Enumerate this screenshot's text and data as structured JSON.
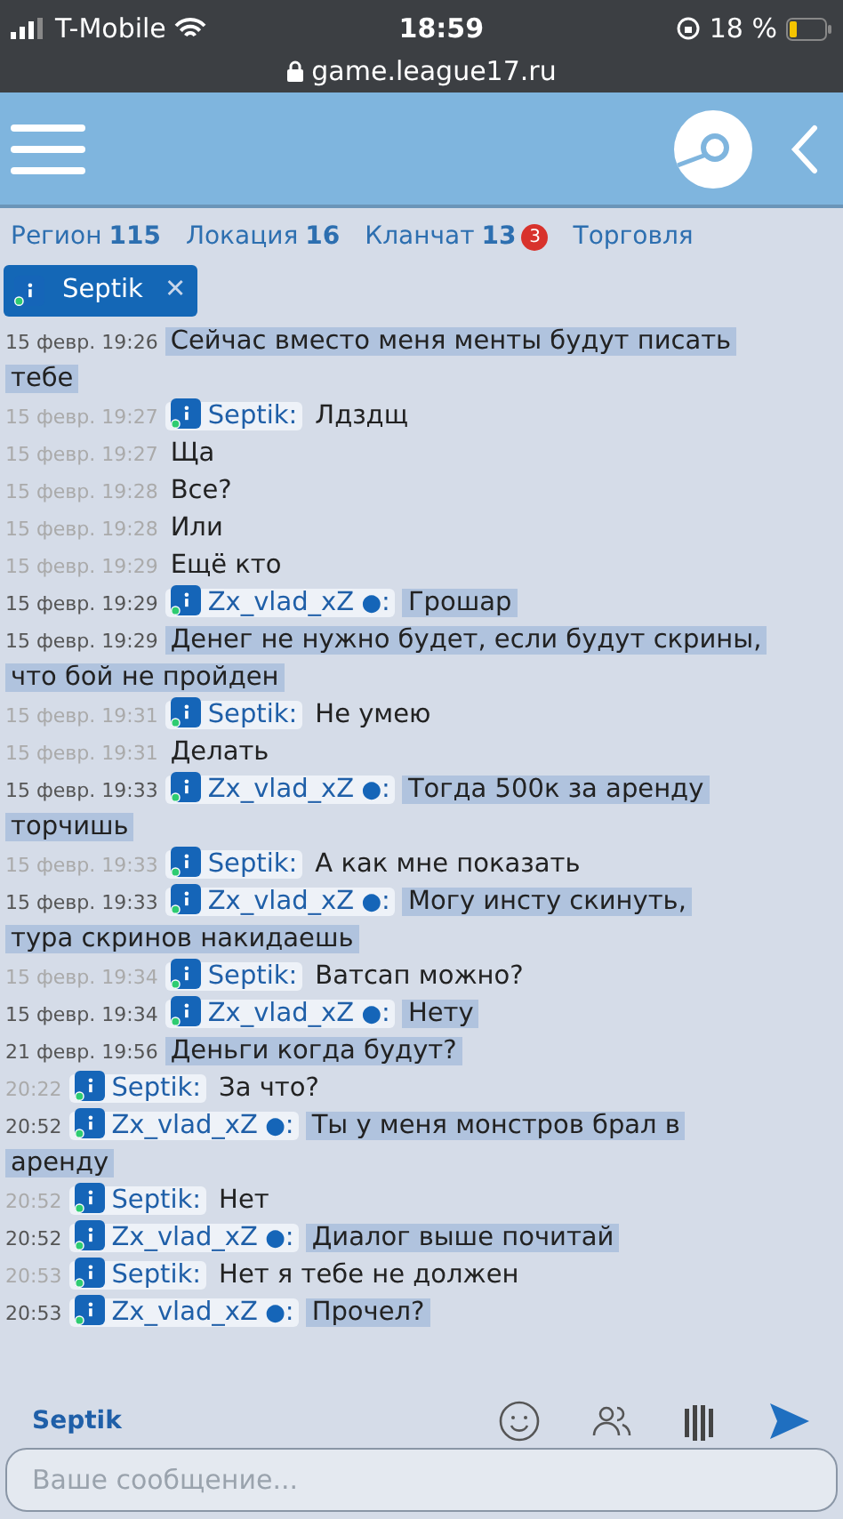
{
  "status_bar": {
    "carrier": "T-Mobile",
    "time": "18:59",
    "battery": "18 %",
    "url": "game.league17.ru"
  },
  "tabs": [
    {
      "label": "Регион",
      "count": "115"
    },
    {
      "label": "Локация",
      "count": "16"
    },
    {
      "label": "Кланчат",
      "count": "13",
      "badge": "3"
    },
    {
      "label": "Торговля"
    }
  ],
  "chip": {
    "label": "Septik",
    "close": "✕"
  },
  "messages": [
    {
      "time": "15 февр. 19:26",
      "lines": [
        "Сейчас вместо меня менты будут писать",
        "тебе"
      ],
      "highlighted": true
    },
    {
      "time": "15 февр. 19:27",
      "sender": "Septik",
      "sep": ":",
      "lines": [
        "Лдздщ"
      ],
      "highlighted": false
    },
    {
      "time": "15 февр. 19:27",
      "lines": [
        "Ща"
      ],
      "highlighted": false
    },
    {
      "time": "15 февр. 19:28",
      "lines": [
        "Все?"
      ],
      "highlighted": false
    },
    {
      "time": "15 февр. 19:28",
      "lines": [
        "Или"
      ],
      "highlighted": false
    },
    {
      "time": "15 февр. 19:29",
      "lines": [
        "Ещё кто"
      ],
      "highlighted": false
    },
    {
      "time": "15 февр. 19:29",
      "sender": "Zx_vlad_xZ",
      "mark": "●",
      "sep": ":",
      "lines": [
        "Грошар"
      ],
      "highlighted": true
    },
    {
      "time": "15 февр. 19:29",
      "lines": [
        "Денег не нужно будет, если будут скрины,",
        "что бой не пройден"
      ],
      "highlighted": true
    },
    {
      "time": "15 февр. 19:31",
      "sender": "Septik",
      "sep": ":",
      "lines": [
        "Не умею"
      ],
      "highlighted": false
    },
    {
      "time": "15 февр. 19:31",
      "lines": [
        "Делать"
      ],
      "highlighted": false
    },
    {
      "time": "15 февр. 19:33",
      "sender": "Zx_vlad_xZ",
      "mark": "●",
      "sep": ":",
      "lines": [
        "Тогда 500к за аренду",
        "торчишь"
      ],
      "highlighted": true
    },
    {
      "time": "15 февр. 19:33",
      "sender": "Septik",
      "sep": ":",
      "lines": [
        "А как мне показать"
      ],
      "highlighted": false
    },
    {
      "time": "15 февр. 19:33",
      "sender": "Zx_vlad_xZ",
      "mark": "●",
      "sep": ":",
      "lines": [
        "Могу инсту скинуть,",
        "тура скринов накидаешь"
      ],
      "highlighted": true
    },
    {
      "time": "15 февр. 19:34",
      "sender": "Septik",
      "sep": ":",
      "lines": [
        "Ватсап можно?"
      ],
      "highlighted": false
    },
    {
      "time": "15 февр. 19:34",
      "sender": "Zx_vlad_xZ",
      "mark": "●",
      "sep": ":",
      "lines": [
        "Нету"
      ],
      "highlighted": true
    },
    {
      "time": "21 февр. 19:56",
      "lines": [
        "Деньги когда будут?"
      ],
      "highlighted": true
    },
    {
      "time": "20:22",
      "sender": "Septik",
      "sep": ":",
      "lines": [
        "За что?"
      ],
      "highlighted": false
    },
    {
      "time": "20:52",
      "sender": "Zx_vlad_xZ",
      "mark": "●",
      "sep": ":",
      "lines": [
        "Ты у меня монстров брал в",
        "аренду"
      ],
      "highlighted": true
    },
    {
      "time": "20:52",
      "sender": "Septik",
      "sep": ":",
      "lines": [
        "Нет"
      ],
      "highlighted": false
    },
    {
      "time": "20:52",
      "sender": "Zx_vlad_xZ",
      "mark": "●",
      "sep": ":",
      "lines": [
        "Диалог выше почитай"
      ],
      "highlighted": true
    },
    {
      "time": "20:53",
      "sender": "Septik",
      "sep": ":",
      "lines": [
        "Нет я тебе не должен"
      ],
      "highlighted": false
    },
    {
      "time": "20:53",
      "sender": "Zx_vlad_xZ",
      "mark": "●",
      "sep": ":",
      "lines": [
        "Прочел?"
      ],
      "highlighted": true
    }
  ],
  "composer": {
    "recipient": "Septik",
    "placeholder": "Ваше сообщение..."
  }
}
